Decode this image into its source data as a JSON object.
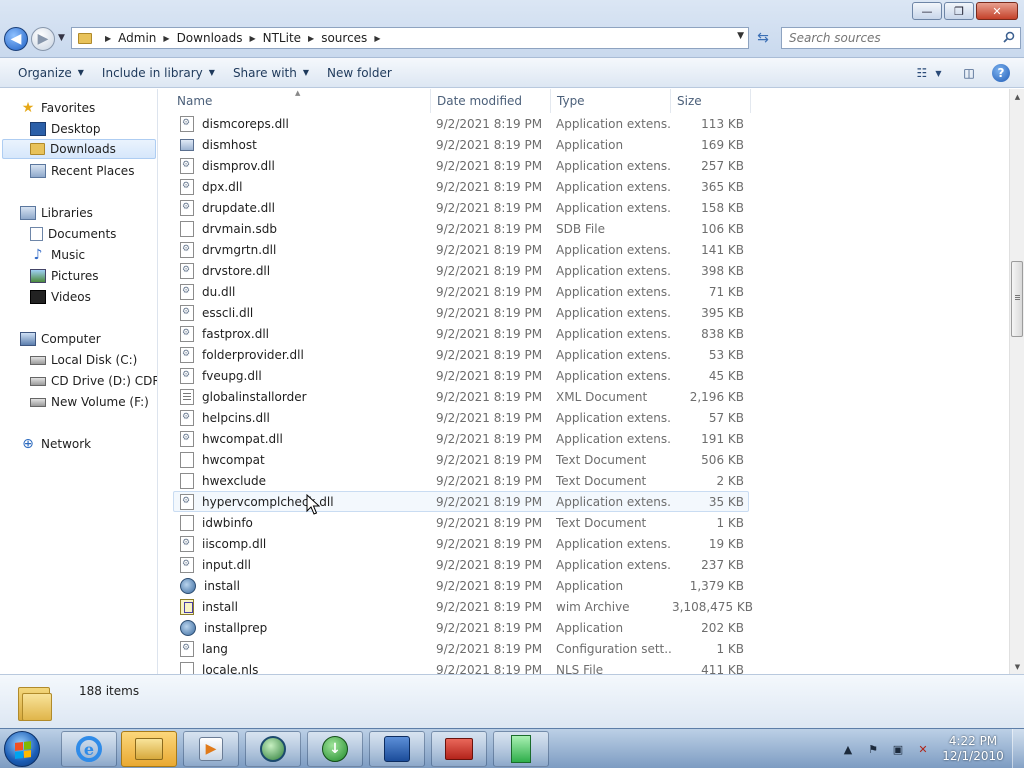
{
  "window": {
    "minimize_label": "—",
    "maximize_label": "❐",
    "close_label": "✕"
  },
  "address": {
    "breadcrumbs": [
      "Admin",
      "Downloads",
      "NTLite",
      "sources"
    ]
  },
  "search": {
    "placeholder": "Search sources"
  },
  "toolbar": {
    "organize": "Organize",
    "include_in_library": "Include in library",
    "share_with": "Share with",
    "new_folder": "New folder"
  },
  "navigation": {
    "favorites": "Favorites",
    "desktop": "Desktop",
    "downloads": "Downloads",
    "recent_places": "Recent Places",
    "libraries": "Libraries",
    "documents": "Documents",
    "music": "Music",
    "pictures": "Pictures",
    "videos": "Videos",
    "computer": "Computer",
    "local_disk": "Local Disk (C:)",
    "cd_drive": "CD Drive (D:) CDROM",
    "new_volume": "New Volume (F:)",
    "network": "Network",
    "selected": "Downloads"
  },
  "columns": {
    "name": "Name",
    "date_modified": "Date modified",
    "type": "Type",
    "size": "Size"
  },
  "files": [
    {
      "name": "dismcoreps.dll",
      "date": "9/2/2021 8:19 PM",
      "type": "Application extens...",
      "size": "113 KB",
      "icon": "dll"
    },
    {
      "name": "dismhost",
      "date": "9/2/2021 8:19 PM",
      "type": "Application",
      "size": "169 KB",
      "icon": "app"
    },
    {
      "name": "dismprov.dll",
      "date": "9/2/2021 8:19 PM",
      "type": "Application extens...",
      "size": "257 KB",
      "icon": "dll"
    },
    {
      "name": "dpx.dll",
      "date": "9/2/2021 8:19 PM",
      "type": "Application extens...",
      "size": "365 KB",
      "icon": "dll"
    },
    {
      "name": "drupdate.dll",
      "date": "9/2/2021 8:19 PM",
      "type": "Application extens...",
      "size": "158 KB",
      "icon": "dll"
    },
    {
      "name": "drvmain.sdb",
      "date": "9/2/2021 8:19 PM",
      "type": "SDB File",
      "size": "106 KB",
      "icon": "sdb"
    },
    {
      "name": "drvmgrtn.dll",
      "date": "9/2/2021 8:19 PM",
      "type": "Application extens...",
      "size": "141 KB",
      "icon": "dll"
    },
    {
      "name": "drvstore.dll",
      "date": "9/2/2021 8:19 PM",
      "type": "Application extens...",
      "size": "398 KB",
      "icon": "dll"
    },
    {
      "name": "du.dll",
      "date": "9/2/2021 8:19 PM",
      "type": "Application extens...",
      "size": "71 KB",
      "icon": "dll"
    },
    {
      "name": "esscli.dll",
      "date": "9/2/2021 8:19 PM",
      "type": "Application extens...",
      "size": "395 KB",
      "icon": "dll"
    },
    {
      "name": "fastprox.dll",
      "date": "9/2/2021 8:19 PM",
      "type": "Application extens...",
      "size": "838 KB",
      "icon": "dll"
    },
    {
      "name": "folderprovider.dll",
      "date": "9/2/2021 8:19 PM",
      "type": "Application extens...",
      "size": "53 KB",
      "icon": "dll"
    },
    {
      "name": "fveupg.dll",
      "date": "9/2/2021 8:19 PM",
      "type": "Application extens...",
      "size": "45 KB",
      "icon": "dll"
    },
    {
      "name": "globalinstallorder",
      "date": "9/2/2021 8:19 PM",
      "type": "XML Document",
      "size": "2,196 KB",
      "icon": "xml"
    },
    {
      "name": "helpcins.dll",
      "date": "9/2/2021 8:19 PM",
      "type": "Application extens...",
      "size": "57 KB",
      "icon": "dll"
    },
    {
      "name": "hwcompat.dll",
      "date": "9/2/2021 8:19 PM",
      "type": "Application extens...",
      "size": "191 KB",
      "icon": "dll"
    },
    {
      "name": "hwcompat",
      "date": "9/2/2021 8:19 PM",
      "type": "Text Document",
      "size": "506 KB",
      "icon": "txt"
    },
    {
      "name": "hwexclude",
      "date": "9/2/2021 8:19 PM",
      "type": "Text Document",
      "size": "2 KB",
      "icon": "txt"
    },
    {
      "name": "hypervcomplcheck.dll",
      "date": "9/2/2021 8:19 PM",
      "type": "Application extens...",
      "size": "35 KB",
      "icon": "dll"
    },
    {
      "name": "idwbinfo",
      "date": "9/2/2021 8:19 PM",
      "type": "Text Document",
      "size": "1 KB",
      "icon": "txt"
    },
    {
      "name": "iiscomp.dll",
      "date": "9/2/2021 8:19 PM",
      "type": "Application extens...",
      "size": "19 KB",
      "icon": "dll"
    },
    {
      "name": "input.dll",
      "date": "9/2/2021 8:19 PM",
      "type": "Application extens...",
      "size": "237 KB",
      "icon": "dll"
    },
    {
      "name": "install",
      "date": "9/2/2021 8:19 PM",
      "type": "Application",
      "size": "1,379 KB",
      "icon": "setup"
    },
    {
      "name": "install",
      "date": "9/2/2021 8:19 PM",
      "type": "wim Archive",
      "size": "3,108,475 KB",
      "icon": "wim"
    },
    {
      "name": "installprep",
      "date": "9/2/2021 8:19 PM",
      "type": "Application",
      "size": "202 KB",
      "icon": "setup"
    },
    {
      "name": "lang",
      "date": "9/2/2021 8:19 PM",
      "type": "Configuration sett...",
      "size": "1 KB",
      "icon": "cfg"
    },
    {
      "name": "locale.nls",
      "date": "9/2/2021 8:19 PM",
      "type": "NLS File",
      "size": "411 KB",
      "icon": "nls"
    }
  ],
  "hovered_row": 18,
  "details": {
    "item_count": "188 items"
  },
  "taskbar": {
    "time": "4:22 PM",
    "date": "12/1/2010"
  }
}
